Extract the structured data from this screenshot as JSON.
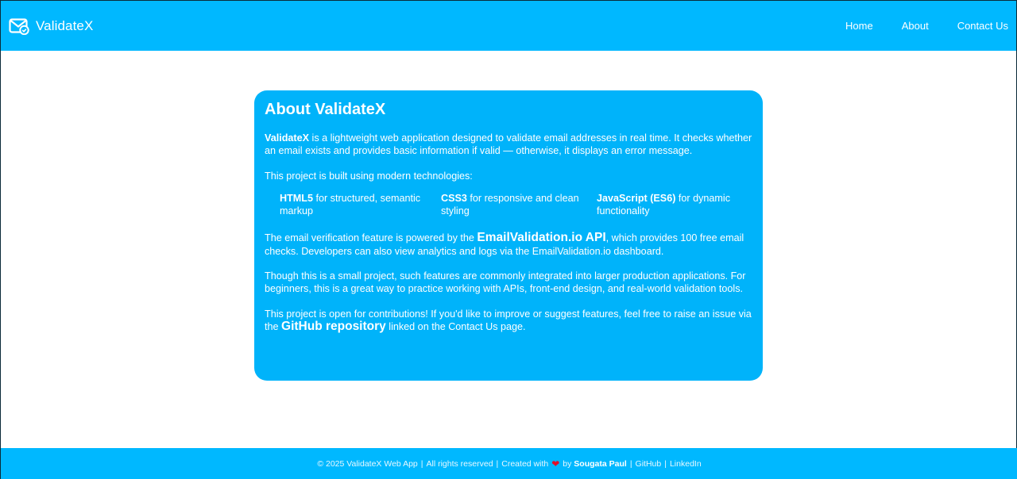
{
  "header": {
    "brand_name": "ValidateX",
    "brand_icon": "mail-check-icon",
    "nav": [
      {
        "label": "Home"
      },
      {
        "label": "About"
      },
      {
        "label": "Contact Us"
      }
    ]
  },
  "about": {
    "title": "About ValidateX",
    "p1_strong": "ValidateX",
    "p1_text": " is a lightweight web application designed to validate email addresses in real time. It checks whether an email exists and provides basic information if valid — otherwise, it displays an error message.",
    "p2": "This project is built using modern technologies:",
    "tech": [
      {
        "name": "HTML5",
        "desc": " for structured, semantic markup"
      },
      {
        "name": "CSS3",
        "desc": " for responsive and clean styling"
      },
      {
        "name": "JavaScript (ES6)",
        "desc": " for dynamic functionality"
      }
    ],
    "p3_pre": "The email verification feature is powered by the ",
    "p3_link": "EmailValidation.io API",
    "p3_post": ", which provides 100 free email checks. Developers can also view analytics and logs via the EmailValidation.io dashboard.",
    "p4": "Though this is a small project, such features are commonly integrated into larger production applications. For beginners, this is a great way to practice working with APIs, front-end design, and real-world validation tools.",
    "p5_pre": "This project is open for contributions! If you'd like to improve or suggest features, feel free to raise an issue via the ",
    "p5_link": "GitHub repository",
    "p5_post": " linked on the Contact Us page."
  },
  "footer": {
    "copyright": "© 2025 ValidateX Web App",
    "rights": "All rights reserved",
    "created_with": "Created with",
    "heart_icon": "heart-icon",
    "by": "by",
    "author": "Sougata Paul",
    "github": "GitHub",
    "linkedin": "LinkedIn"
  },
  "colors": {
    "header_bg": "#00b8ff",
    "card_bg": "#00b3fa",
    "text": "#ffffff"
  }
}
